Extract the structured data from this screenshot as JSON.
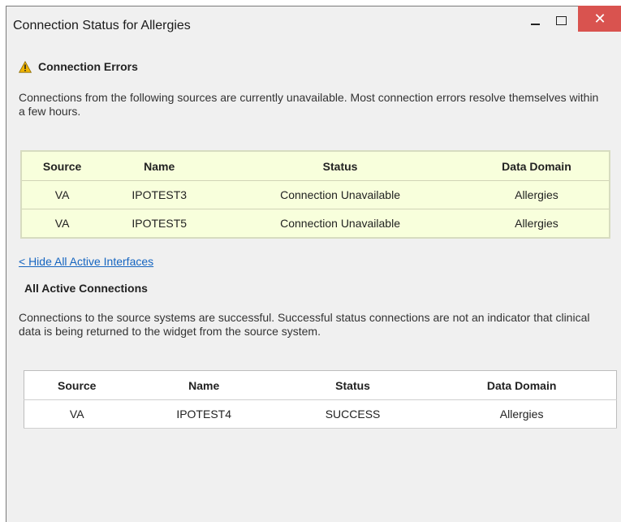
{
  "window": {
    "title": "Connection Status for Allergies",
    "close_glyph": "✕"
  },
  "errors": {
    "heading": "Connection Errors",
    "description": "Connections from the following sources are currently unavailable. Most connection errors resolve themselves within a few hours.",
    "columns": [
      "Source",
      "Name",
      "Status",
      "Data Domain"
    ],
    "rows": [
      [
        "VA",
        "IPOTEST3",
        "Connection Unavailable",
        "Allergies"
      ],
      [
        "VA",
        "IPOTEST5",
        "Connection Unavailable",
        "Allergies"
      ]
    ]
  },
  "toggle_link": "< Hide All Active Interfaces",
  "active": {
    "heading": "All Active Connections",
    "description": "Connections to the source systems are successful. Successful status connections are not an indicator that clinical data is being returned to the widget from the source system.",
    "columns": [
      "Source",
      "Name",
      "Status",
      "Data Domain"
    ],
    "rows": [
      [
        "VA",
        "IPOTEST4",
        "SUCCESS",
        "Allergies"
      ]
    ]
  },
  "colors": {
    "error_table_bg": "#f8ffdc",
    "close_button": "#d9534f",
    "link": "#1565c0",
    "warning_icon": "#f0b400"
  },
  "icons": {
    "warning": "warning-triangle-icon",
    "minimize": "minimize-icon",
    "maximize": "maximize-icon",
    "close": "close-icon"
  }
}
